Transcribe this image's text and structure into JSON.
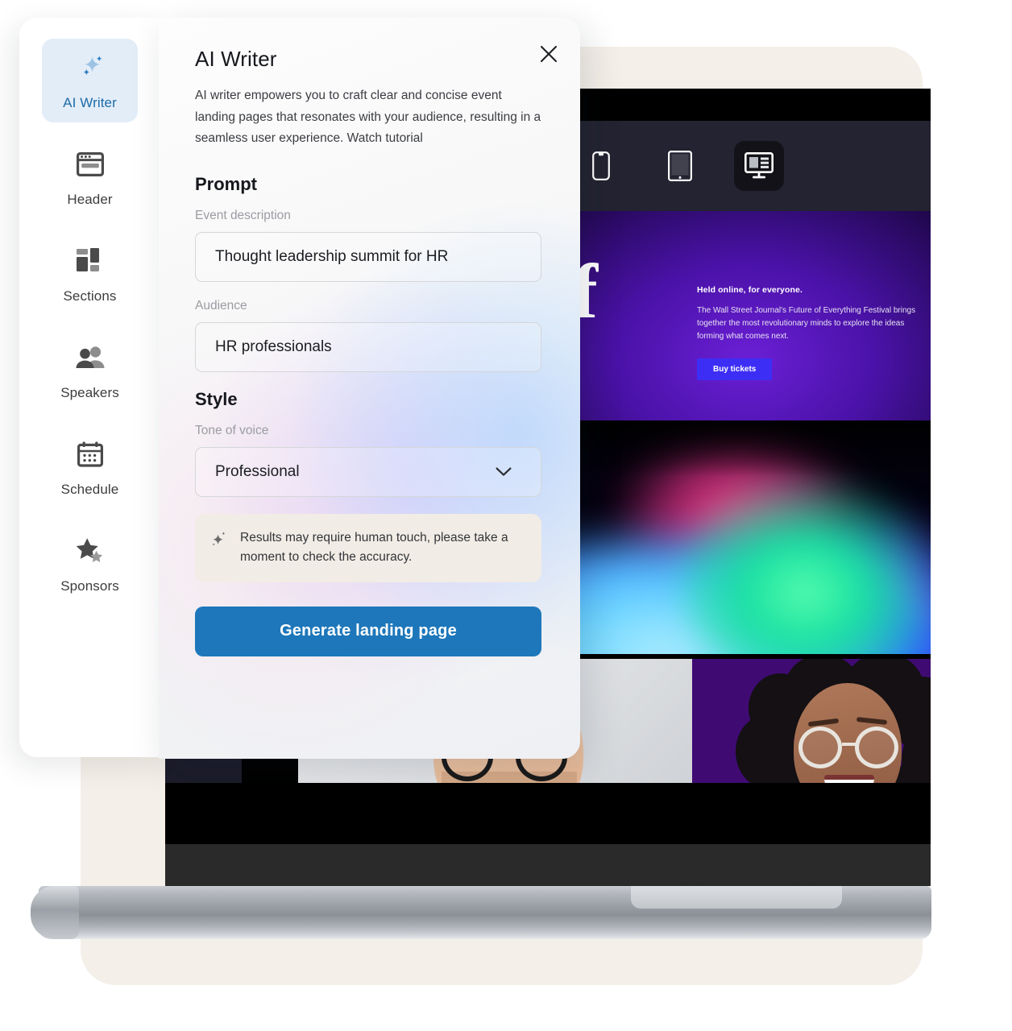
{
  "sidebar": {
    "items": [
      {
        "label": "AI Writer",
        "icon": "sparkle-icon",
        "active": true
      },
      {
        "label": "Header",
        "icon": "browser-window-icon",
        "active": false
      },
      {
        "label": "Sections",
        "icon": "layout-blocks-icon",
        "active": false
      },
      {
        "label": "Speakers",
        "icon": "people-icon",
        "active": false
      },
      {
        "label": "Schedule",
        "icon": "calendar-icon",
        "active": false
      },
      {
        "label": "Sponsors",
        "icon": "stars-icon",
        "active": false
      }
    ]
  },
  "panel": {
    "title": "AI Writer",
    "description": "AI writer empowers you to craft clear and concise event landing pages that resonates with your audience, resulting in a seamless user experience. Watch tutorial",
    "close_icon": "close-icon",
    "prompt": {
      "heading": "Prompt",
      "event_description": {
        "label": "Event description",
        "value": "Thought leadership summit for HR",
        "placeholder": "Event description"
      },
      "audience": {
        "label": "Audience",
        "value": "HR professionals",
        "placeholder": "Audience"
      }
    },
    "style": {
      "heading": "Style",
      "tone_of_voice": {
        "label": "Tone of voice",
        "value": "Professional",
        "chevron_icon": "chevron-down-icon",
        "options": [
          "Professional"
        ]
      }
    },
    "notice": {
      "icon": "sparkle-icon",
      "text": "Results may require human touch, please take a moment to check the accuracy."
    },
    "generate_label": "Generate landing page",
    "accent_color": "#1d77ba",
    "active_tab_bg": "#e3edf8",
    "active_tab_text": "#1c6ba8"
  },
  "preview": {
    "device_toolbar": [
      {
        "name": "mobile-view",
        "icon": "phone-icon",
        "active": false
      },
      {
        "name": "tablet-view",
        "icon": "tablet-icon",
        "active": false
      },
      {
        "name": "desktop-view",
        "icon": "desktop-icon",
        "active": true
      }
    ],
    "hero": {
      "big_letter": "f",
      "kicker": "Held online, for everyone.",
      "body": "The Wall Street Journal's Future of Everything Festival brings together the most revolutionary minds to explore the ideas forming what comes next.",
      "cta_label": "Buy tickets",
      "cta_color": "#3d2ef5"
    },
    "background_color": "#f4efe8"
  }
}
